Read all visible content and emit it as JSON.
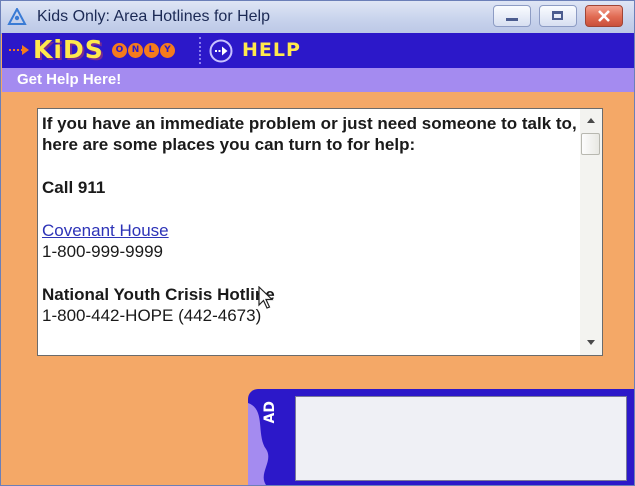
{
  "window": {
    "title": "Kids Only: Area Hotlines for Help"
  },
  "toolbar": {
    "logo_text": "KiDS",
    "logo_only_letters": [
      "O",
      "N",
      "L",
      "Y"
    ],
    "help_label": "HELP"
  },
  "subheader": {
    "text": "Get Help Here!"
  },
  "content": {
    "intro": "If you have an immediate problem or just need someone to talk to, here are some places you can turn to for help:",
    "call": "Call 911",
    "entries": [
      {
        "name": "Covenant House",
        "phone": "1-800-999-9999",
        "is_link": true
      },
      {
        "name": "National Youth Crisis Hotline",
        "phone": "1-800-442-HOPE (442-4673)",
        "is_link": false
      }
    ]
  },
  "ad": {
    "label": "AD"
  },
  "colors": {
    "toolbar": "#2c18c9",
    "subheader": "#a48bf0",
    "background": "#f4a867",
    "link": "#2d33b7",
    "logo": "#ffe94d"
  }
}
